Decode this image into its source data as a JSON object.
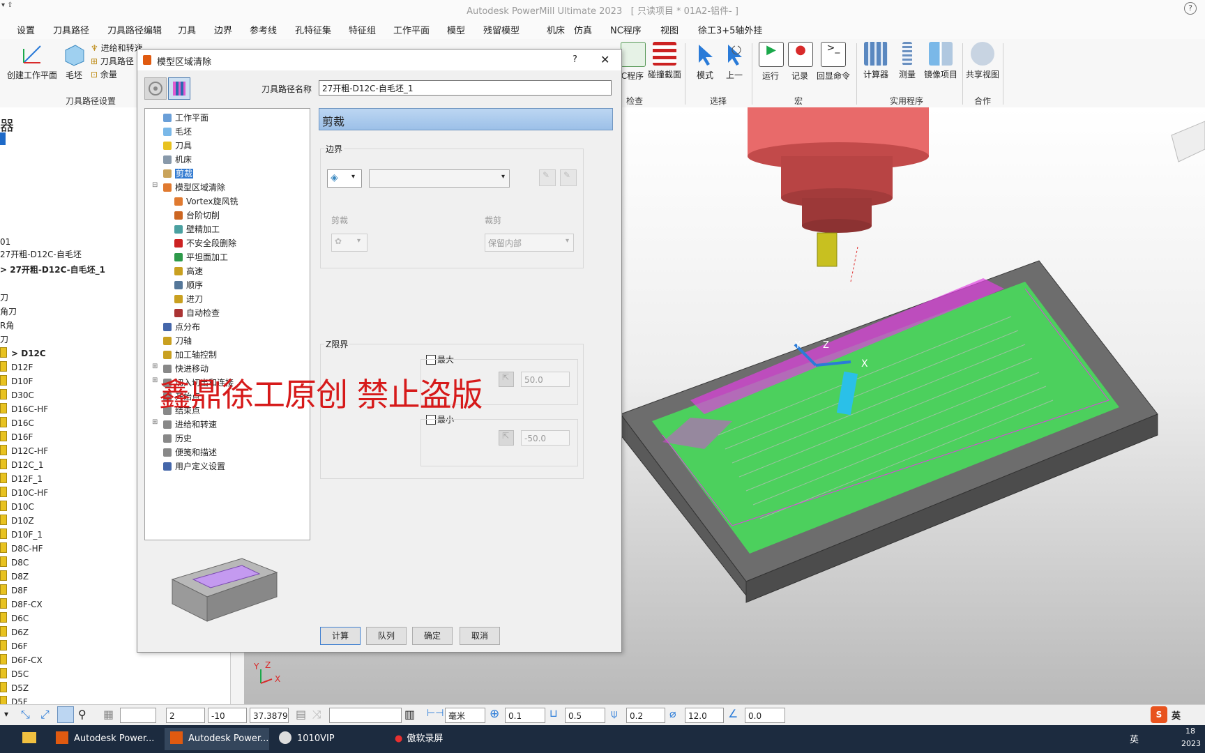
{
  "app": {
    "title": "Autodesk PowerMill Ultimate 2023",
    "project": "[ 只读项目 * 01A2-铝件- ]",
    "help_label": "?"
  },
  "tabs": [
    "设置",
    "刀具路径",
    "刀具路径编辑",
    "刀具",
    "边界",
    "参考线",
    "孔特征集",
    "特征组",
    "工作平面",
    "模型",
    "残留模型",
    "机床",
    "仿真",
    "NC程序",
    "视图",
    "徐工3+5轴外挂"
  ],
  "ribbon": {
    "left": {
      "create_workplane": "创建工作平面",
      "block": "毛坯",
      "feed_and_speed": "进给和转速",
      "toolpath_conn": "刀具路径",
      "allowance": "余量",
      "group_label": "刀具路径设置"
    },
    "check": {
      "nc_program": "C程序",
      "collision": "碰撞截面",
      "group_label": "检查"
    },
    "select": {
      "mode": "模式",
      "prev": "上一",
      "group_label": "选择"
    },
    "macro": {
      "run": "运行",
      "record": "记录",
      "echo": "回显命令",
      "group_label": "宏"
    },
    "utilities": {
      "calculator": "计算器",
      "measure": "测量",
      "mirror": "镜像项目",
      "group_label": "实用程序"
    },
    "collab": {
      "share": "共享视图",
      "group_label": "合作"
    }
  },
  "explorer": {
    "header": "器",
    "rows": [
      "01",
      "27开粗-D12C-自毛坯",
      "> 27开粗-D12C-自毛坯_1",
      "刀",
      "角刀",
      "R角",
      "刀"
    ],
    "tools": [
      "> D12C",
      "D12F",
      "D10F",
      "D30C",
      "D16C-HF",
      "D16C",
      "D16F",
      "D12C-HF",
      "D12C_1",
      "D12F_1",
      "D10C-HF",
      "D10C",
      "D10Z",
      "D10F_1",
      "D8C-HF",
      "D8C",
      "D8Z",
      "D8F",
      "D8F-CX",
      "D6C",
      "D6Z",
      "D6F",
      "D6F-CX",
      "D5C",
      "D5Z",
      "D5F"
    ]
  },
  "dialog": {
    "title": "模型区域清除",
    "help": "?",
    "close": "✕",
    "toolpath_name_label": "刀具路径名称",
    "toolpath_name": "27开粗-D12C-自毛坯_1",
    "tree": [
      {
        "label": "工作平面",
        "icon": "workplane-icon",
        "indent": 1,
        "color": "#6a9fd8"
      },
      {
        "label": "毛坯",
        "icon": "block-icon",
        "indent": 1,
        "color": "#7ab8e8"
      },
      {
        "label": "刀具",
        "icon": "tool-icon",
        "indent": 1,
        "color": "#e8c220"
      },
      {
        "label": "机床",
        "icon": "machine-icon",
        "indent": 1,
        "color": "#8899aa"
      },
      {
        "label": "剪裁",
        "icon": "trim-icon",
        "indent": 1,
        "color": "#c9a35a",
        "selected": true
      },
      {
        "label": "模型区域清除",
        "icon": "area-clear-icon",
        "indent": 1,
        "color": "#e07a30",
        "expanded": true
      },
      {
        "label": "Vortex旋风铣",
        "icon": "vortex-icon",
        "indent": 2,
        "color": "#e07a30"
      },
      {
        "label": "台阶切削",
        "icon": "step-icon",
        "indent": 2,
        "color": "#cc6622"
      },
      {
        "label": "壁精加工",
        "icon": "wall-icon",
        "indent": 2,
        "color": "#4aa0a0"
      },
      {
        "label": "不安全段删除",
        "icon": "unsafe-icon",
        "indent": 2,
        "color": "#cc2222"
      },
      {
        "label": "平坦面加工",
        "icon": "flat-icon",
        "indent": 2,
        "color": "#2e9a4a"
      },
      {
        "label": "高速",
        "icon": "highspeed-icon",
        "indent": 2,
        "color": "#c9a020"
      },
      {
        "label": "顺序",
        "icon": "order-icon",
        "indent": 2,
        "color": "#557799"
      },
      {
        "label": "进刀",
        "icon": "leadin-icon",
        "indent": 2,
        "color": "#c9a020"
      },
      {
        "label": "自动检查",
        "icon": "autocheck-icon",
        "indent": 2,
        "color": "#aa3333"
      },
      {
        "label": "点分布",
        "icon": "points-icon",
        "indent": 1,
        "color": "#4466aa"
      },
      {
        "label": "刀轴",
        "icon": "axis-icon",
        "indent": 1,
        "color": "#c9a020"
      },
      {
        "label": "加工轴控制",
        "icon": "axis-control-icon",
        "indent": 1,
        "color": "#c9a020"
      },
      {
        "label": "快进移动",
        "icon": "rapid-icon",
        "indent": 1,
        "color": "#888888",
        "collapsed": true
      },
      {
        "label": "切入切出和连接",
        "icon": "links-icon",
        "indent": 1,
        "color": "#888888",
        "collapsed": true
      },
      {
        "label": "开始点",
        "icon": "start-icon",
        "indent": 1,
        "color": "#888888"
      },
      {
        "label": "结束点",
        "icon": "end-icon",
        "indent": 1,
        "color": "#888888"
      },
      {
        "label": "进给和转速",
        "icon": "feed-icon",
        "indent": 1,
        "color": "#888888",
        "collapsed": true
      },
      {
        "label": "历史",
        "icon": "history-icon",
        "indent": 1,
        "color": "#888888"
      },
      {
        "label": "便笺和描述",
        "icon": "notes-icon",
        "indent": 1,
        "color": "#888888"
      },
      {
        "label": "用户定义设置",
        "icon": "user-icon",
        "indent": 1,
        "color": "#4466aa"
      }
    ],
    "page_header": "剪裁",
    "boundary_label": "边界",
    "trim_label": "剪裁",
    "clip_label": "裁剪",
    "clip_value": "保留内部",
    "zlimit_label": "Z限界",
    "max_label": "最大",
    "max_value": "50.0",
    "min_label": "最小",
    "min_value": "-50.0",
    "buttons": {
      "calculate": "计算",
      "queue": "队列",
      "ok": "确定",
      "cancel": "取消"
    }
  },
  "watermark": "鑫鼎徐工原创 禁止盗版",
  "viewport": {
    "axis_x": "X",
    "axis_y": "Y",
    "axis_z": "Z"
  },
  "statusbar": {
    "fields": [
      "2",
      "-10",
      "37.3879"
    ],
    "unit": "毫米",
    "tol": "0.1",
    "thickness": "0.5",
    "tool_val": "0.2",
    "diameter": "12.0",
    "angle": "0.0"
  },
  "taskbar": {
    "items": [
      "Autodesk Power...",
      "Autodesk Power...",
      "1010VIP",
      "傲软录屏"
    ],
    "ime": "英",
    "time": "18",
    "date": "2023"
  }
}
